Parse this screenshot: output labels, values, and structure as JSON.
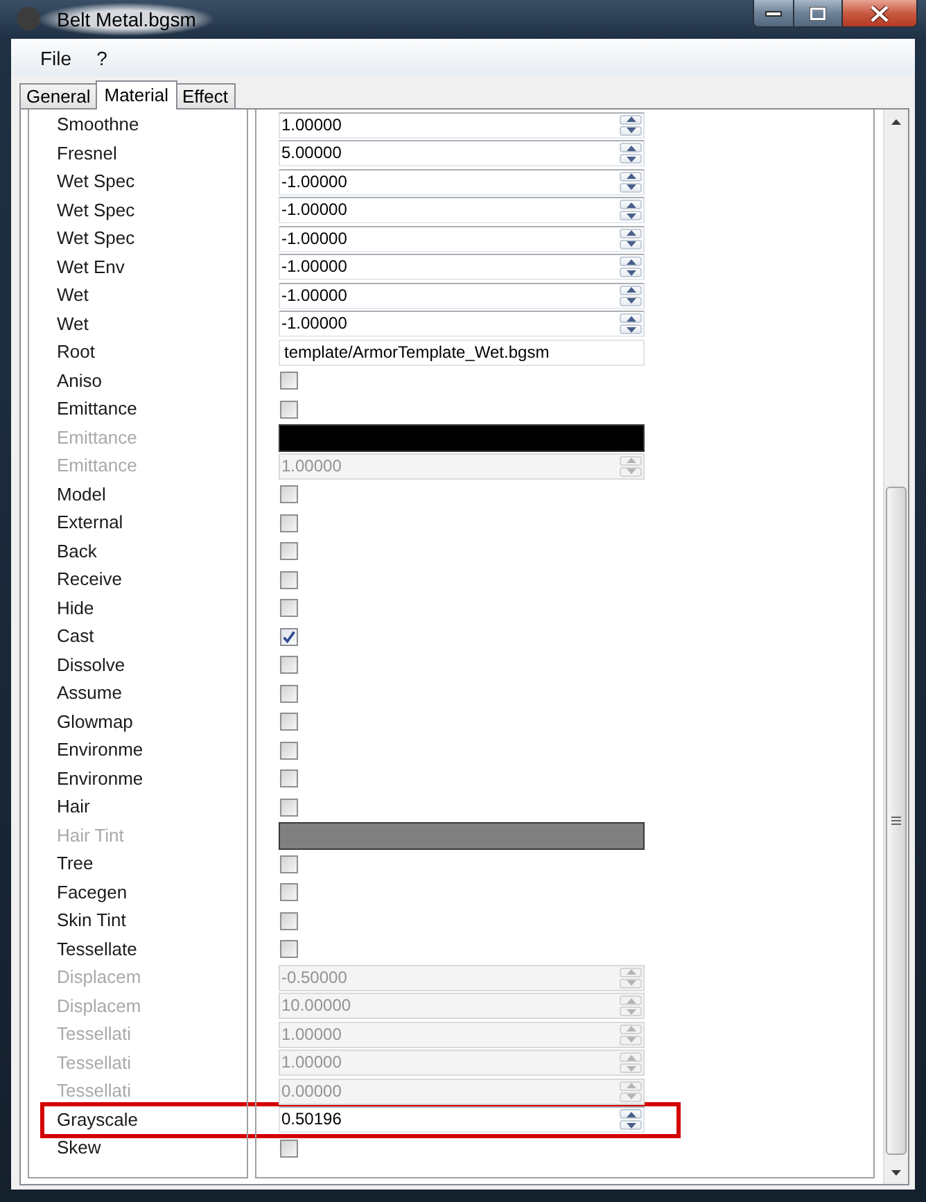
{
  "window": {
    "title": "Belt Metal.bgsm"
  },
  "menu": [
    "File",
    "?"
  ],
  "tabs": [
    {
      "label": "General",
      "selected": false
    },
    {
      "label": "Material",
      "selected": true
    },
    {
      "label": "Effect",
      "selected": false
    }
  ],
  "rows": [
    {
      "label": "Smoothne",
      "kind": "spin",
      "value": "1.00000",
      "disabled": false,
      "highlighted": false
    },
    {
      "label": "Fresnel",
      "kind": "spin",
      "value": "5.00000",
      "disabled": false,
      "highlighted": false
    },
    {
      "label": "Wet Spec",
      "kind": "spin",
      "value": "-1.00000",
      "disabled": false,
      "highlighted": false
    },
    {
      "label": "Wet Spec",
      "kind": "spin",
      "value": "-1.00000",
      "disabled": false,
      "highlighted": false
    },
    {
      "label": "Wet Spec",
      "kind": "spin",
      "value": "-1.00000",
      "disabled": false,
      "highlighted": false
    },
    {
      "label": "Wet Env",
      "kind": "spin",
      "value": "-1.00000",
      "disabled": false,
      "highlighted": false
    },
    {
      "label": "Wet",
      "kind": "spin",
      "value": "-1.00000",
      "disabled": false,
      "highlighted": false
    },
    {
      "label": "Wet",
      "kind": "spin",
      "value": "-1.00000",
      "disabled": false,
      "highlighted": false
    },
    {
      "label": "Root",
      "kind": "text",
      "value": "template/ArmorTemplate_Wet.bgsm",
      "disabled": false,
      "highlighted": false
    },
    {
      "label": "Aniso",
      "kind": "check",
      "checked": false,
      "disabled": false,
      "highlighted": false
    },
    {
      "label": "Emittance",
      "kind": "check",
      "checked": false,
      "disabled": false,
      "highlighted": false
    },
    {
      "label": "Emittance",
      "kind": "color",
      "color": "#000000",
      "disabled": true,
      "highlighted": false
    },
    {
      "label": "Emittance",
      "kind": "spin",
      "value": "1.00000",
      "disabled": true,
      "highlighted": false
    },
    {
      "label": "Model",
      "kind": "check",
      "checked": false,
      "disabled": false,
      "highlighted": false
    },
    {
      "label": "External",
      "kind": "check",
      "checked": false,
      "disabled": false,
      "highlighted": false
    },
    {
      "label": "Back",
      "kind": "check",
      "checked": false,
      "disabled": false,
      "highlighted": false
    },
    {
      "label": "Receive",
      "kind": "check",
      "checked": false,
      "disabled": false,
      "highlighted": false
    },
    {
      "label": "Hide",
      "kind": "check",
      "checked": false,
      "disabled": false,
      "highlighted": false
    },
    {
      "label": "Cast",
      "kind": "check",
      "checked": true,
      "disabled": false,
      "highlighted": false
    },
    {
      "label": "Dissolve",
      "kind": "check",
      "checked": false,
      "disabled": false,
      "highlighted": false
    },
    {
      "label": "Assume",
      "kind": "check",
      "checked": false,
      "disabled": false,
      "highlighted": false
    },
    {
      "label": "Glowmap",
      "kind": "check",
      "checked": false,
      "disabled": false,
      "highlighted": false
    },
    {
      "label": "Environme",
      "kind": "check",
      "checked": false,
      "disabled": false,
      "highlighted": false
    },
    {
      "label": "Environme",
      "kind": "check",
      "checked": false,
      "disabled": false,
      "highlighted": false
    },
    {
      "label": "Hair",
      "kind": "check",
      "checked": false,
      "disabled": false,
      "highlighted": false
    },
    {
      "label": "Hair Tint",
      "kind": "color",
      "color": "#808080",
      "disabled": true,
      "highlighted": false
    },
    {
      "label": "Tree",
      "kind": "check",
      "checked": false,
      "disabled": false,
      "highlighted": false
    },
    {
      "label": "Facegen",
      "kind": "check",
      "checked": false,
      "disabled": false,
      "highlighted": false
    },
    {
      "label": "Skin Tint",
      "kind": "check",
      "checked": false,
      "disabled": false,
      "highlighted": false
    },
    {
      "label": "Tessellate",
      "kind": "check",
      "checked": false,
      "disabled": false,
      "highlighted": false
    },
    {
      "label": "Displacem",
      "kind": "spin",
      "value": "-0.50000",
      "disabled": true,
      "highlighted": false
    },
    {
      "label": "Displacem",
      "kind": "spin",
      "value": "10.00000",
      "disabled": true,
      "highlighted": false
    },
    {
      "label": "Tessellati",
      "kind": "spin",
      "value": "1.00000",
      "disabled": true,
      "highlighted": false
    },
    {
      "label": "Tessellati",
      "kind": "spin",
      "value": "1.00000",
      "disabled": true,
      "highlighted": false
    },
    {
      "label": "Tessellati",
      "kind": "spin",
      "value": "0.00000",
      "disabled": true,
      "highlighted": false
    },
    {
      "label": "Grayscale",
      "kind": "spin",
      "value": "0.50196",
      "disabled": false,
      "highlighted": true
    },
    {
      "label": "Skew",
      "kind": "check",
      "checked": false,
      "disabled": false,
      "highlighted": false
    }
  ]
}
